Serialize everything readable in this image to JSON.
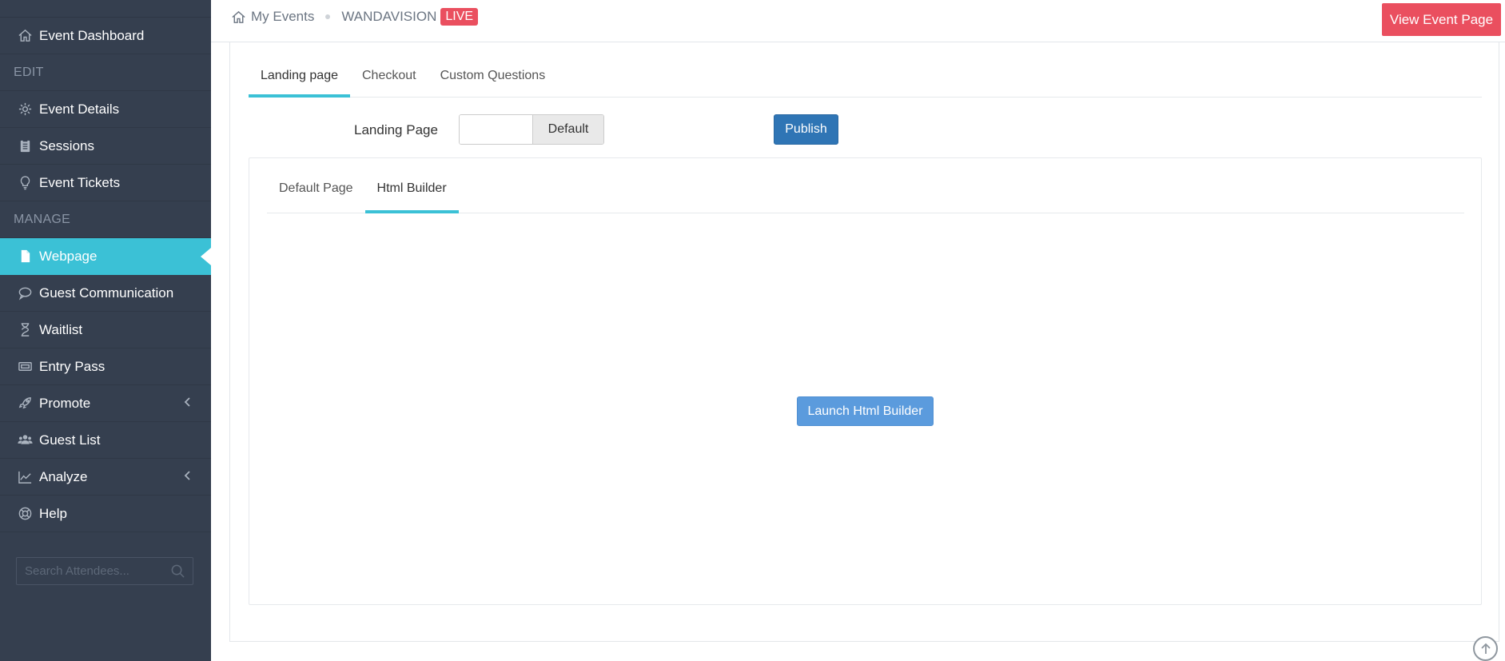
{
  "sidebar": {
    "items": [
      {
        "label": "Event Dashboard",
        "icon": "home-icon"
      },
      {
        "header": "EDIT"
      },
      {
        "label": "Event Details",
        "icon": "gear-icon"
      },
      {
        "label": "Sessions",
        "icon": "clipboard-icon"
      },
      {
        "label": "Event Tickets",
        "icon": "lightbulb-icon"
      },
      {
        "header": "MANAGE"
      },
      {
        "label": "Webpage",
        "icon": "file-icon",
        "active": true
      },
      {
        "label": "Guest Communication",
        "icon": "chat-icon"
      },
      {
        "label": "Waitlist",
        "icon": "hourglass-icon"
      },
      {
        "label": "Entry Pass",
        "icon": "ticket-icon"
      },
      {
        "label": "Promote",
        "icon": "rocket-icon",
        "expandable": true
      },
      {
        "label": "Guest List",
        "icon": "users-icon"
      },
      {
        "label": "Analyze",
        "icon": "chart-icon",
        "expandable": true
      },
      {
        "label": "Help",
        "icon": "lifebuoy-icon"
      }
    ],
    "search_placeholder": "Search Attendees..."
  },
  "topbar": {
    "breadcrumb_home": "My Events",
    "event_name": "WANDAVISION",
    "status_badge": "LIVE",
    "view_button": "View Event Page"
  },
  "main": {
    "tabs": [
      {
        "label": "Landing page",
        "active": true
      },
      {
        "label": "Checkout"
      },
      {
        "label": "Custom Questions"
      }
    ],
    "landing_label": "Landing Page",
    "toggle_value": "Default",
    "publish_button": "Publish",
    "inner_tabs": [
      {
        "label": "Default Page"
      },
      {
        "label": "Html Builder",
        "active": true
      }
    ],
    "launch_button": "Launch Html Builder"
  },
  "colors": {
    "sidebar_bg": "#353f4f",
    "accent": "#3bc1d6",
    "danger": "#ea4f5f",
    "primary": "#2f75b5",
    "launch": "#5b9bdd"
  }
}
